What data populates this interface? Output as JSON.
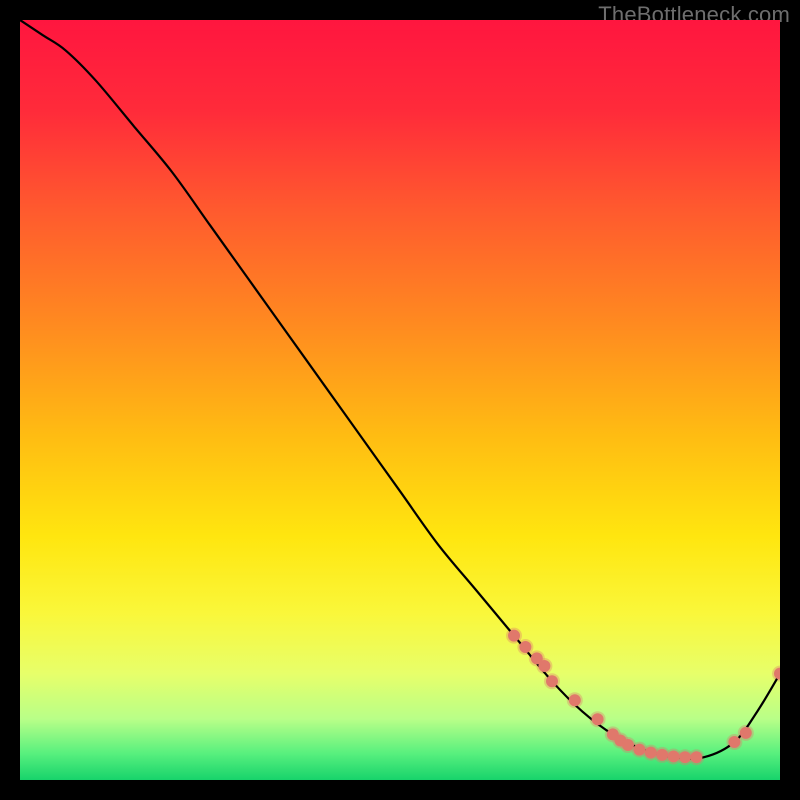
{
  "watermark": "TheBottleneck.com",
  "chart_data": {
    "type": "line",
    "title": "",
    "xlabel": "",
    "ylabel": "",
    "xlim": [
      0,
      100
    ],
    "ylim": [
      0,
      100
    ],
    "background_gradient": {
      "stops": [
        {
          "offset": 0.0,
          "color": "#ff163f"
        },
        {
          "offset": 0.12,
          "color": "#ff2b3a"
        },
        {
          "offset": 0.25,
          "color": "#ff5a2e"
        },
        {
          "offset": 0.4,
          "color": "#ff8a20"
        },
        {
          "offset": 0.55,
          "color": "#ffbd12"
        },
        {
          "offset": 0.68,
          "color": "#ffe60f"
        },
        {
          "offset": 0.78,
          "color": "#faf73a"
        },
        {
          "offset": 0.86,
          "color": "#e7ff6a"
        },
        {
          "offset": 0.92,
          "color": "#b8ff88"
        },
        {
          "offset": 0.965,
          "color": "#58f07e"
        },
        {
          "offset": 1.0,
          "color": "#17d36b"
        }
      ]
    },
    "series": [
      {
        "name": "bottleneck-curve",
        "x": [
          0,
          3,
          6,
          10,
          15,
          20,
          25,
          30,
          35,
          40,
          45,
          50,
          55,
          60,
          65,
          70,
          74,
          78,
          82,
          86,
          90,
          94,
          97,
          100
        ],
        "y": [
          100,
          98,
          96,
          92,
          86,
          80,
          73,
          66,
          59,
          52,
          45,
          38,
          31,
          25,
          19,
          13,
          9,
          6,
          4,
          3,
          3,
          5,
          9,
          14
        ]
      }
    ],
    "markers": {
      "name": "highlight-points",
      "color": "#e0786b",
      "radius": 6,
      "x": [
        65,
        66.5,
        68,
        69,
        70,
        73,
        76,
        78,
        79,
        80,
        81.5,
        83,
        84.5,
        86,
        87.5,
        89,
        94,
        95.5,
        100
      ],
      "y": [
        19,
        17.5,
        16,
        15,
        13,
        10.5,
        8,
        6,
        5.2,
        4.6,
        4,
        3.6,
        3.3,
        3.1,
        3,
        3,
        5,
        6.2,
        14
      ]
    }
  }
}
